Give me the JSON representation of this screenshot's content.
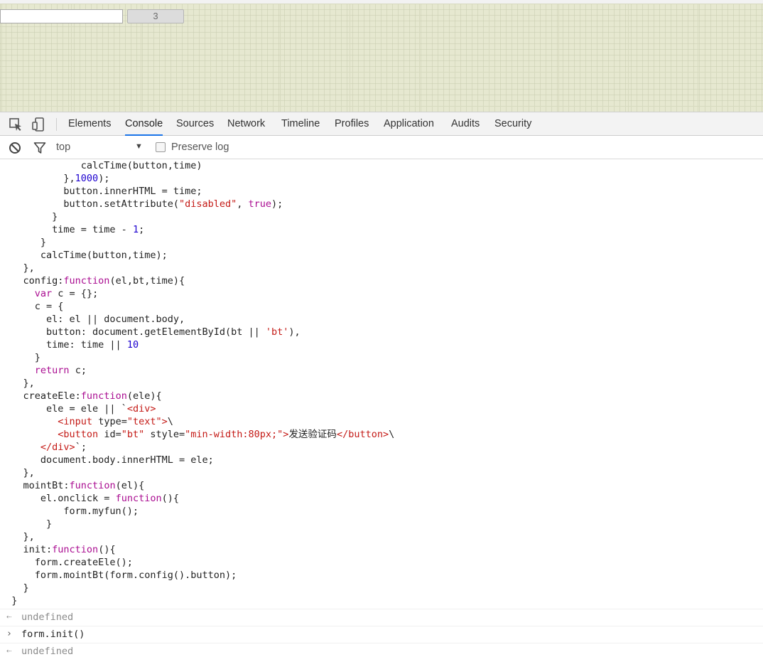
{
  "page": {
    "input_value": "",
    "button_label": "3"
  },
  "devtools": {
    "tabs": [
      "Elements",
      "Console",
      "Sources",
      "Network",
      "Timeline",
      "Profiles",
      "Application",
      "Audits",
      "Security"
    ],
    "active_tab": "Console",
    "toolbar": {
      "context": "top",
      "preserve_log_label": "Preserve log",
      "preserve_log_checked": false
    }
  },
  "console": {
    "code_lines": [
      "              calcTime(button,time)",
      "           },1000);",
      "           button.innerHTML = time;",
      "           button.setAttribute(\"disabled\", true);",
      "         }",
      "         time = time - 1;",
      "       }",
      "       calcTime(button,time);",
      "    },",
      "    config:function(el,bt,time){",
      "      var c = {};",
      "      c = {",
      "        el: el || document.body,",
      "        button: document.getElementById(bt || 'bt'),",
      "        time: time || 10",
      "      }",
      "      return c;",
      "    },",
      "    createEle:function(ele){",
      "        ele = ele || `<div>",
      "          <input type=\"text\">\\",
      "          <button id=\"bt\" style=\"min-width:80px;\">发送验证码</button>\\",
      "       </div>`;",
      "       document.body.innerHTML = ele;",
      "    },",
      "    mointBt:function(el){",
      "       el.onclick = function(){",
      "           form.myfun();",
      "        }",
      "    },",
      "    init:function(){",
      "      form.createEle();",
      "      form.mointBt(form.config().button);",
      "    }",
      "  }"
    ],
    "messages": [
      {
        "kind": "result",
        "text": "undefined"
      },
      {
        "kind": "input",
        "text": "form.init()"
      },
      {
        "kind": "result",
        "text": "undefined"
      }
    ]
  }
}
